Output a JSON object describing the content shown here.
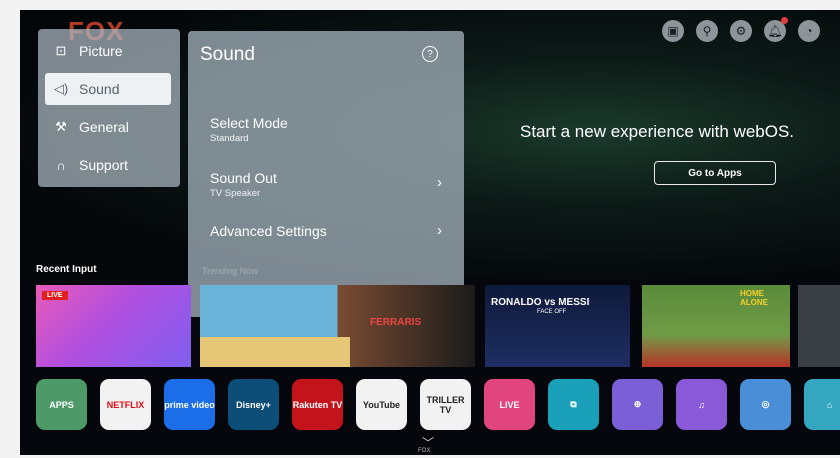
{
  "brand_logo": "FOX",
  "top_icons": [
    "input-icon",
    "search-icon",
    "settings-icon",
    "notifications-icon",
    "account-icon"
  ],
  "promo": {
    "text": "Start a new experience with webOS.",
    "button": "Go to Apps"
  },
  "sidebar": {
    "items": [
      {
        "label": "Picture",
        "icon": "picture-icon"
      },
      {
        "label": "Sound",
        "icon": "speaker-icon",
        "selected": true
      },
      {
        "label": "General",
        "icon": "wrench-icon"
      },
      {
        "label": "Support",
        "icon": "headset-icon"
      }
    ]
  },
  "panel": {
    "title": "Sound",
    "options": [
      {
        "label": "Select Mode",
        "value": "Standard"
      },
      {
        "label": "Sound Out",
        "value": "TV Speaker"
      },
      {
        "label": "Advanced Settings",
        "value": ""
      }
    ],
    "faded_text": "Trending Now"
  },
  "recent_input": "Recent Input",
  "cards": {
    "live_badge": "LIVE",
    "card2_tag": "FERRARIS",
    "card3_title": "RONALDO vs MESSI",
    "card3_sub": "FACE OFF",
    "card4_title": "HOME ALONE"
  },
  "apps": [
    {
      "name": "apps",
      "label": "APPS",
      "bg": "#4d9a68"
    },
    {
      "name": "netflix",
      "label": "NETFLIX",
      "bg": "#f2f2f2",
      "color": "#e50914"
    },
    {
      "name": "prime-video",
      "label": "prime video",
      "bg": "#1b6ee8"
    },
    {
      "name": "disney-plus",
      "label": "Disney+",
      "bg": "#0d4e78"
    },
    {
      "name": "rakuten",
      "label": "Rakuten TV",
      "bg": "#c4141b"
    },
    {
      "name": "youtube",
      "label": "YouTube",
      "bg": "#f2f2f2",
      "color": "#222"
    },
    {
      "name": "triller",
      "label": "TRILLER TV",
      "bg": "#f2f2f2",
      "color": "#222"
    },
    {
      "name": "live-tv",
      "label": "LIVE",
      "bg": "#e0457e"
    },
    {
      "name": "screen-share",
      "label": "⧉",
      "bg": "#1aa0b8"
    },
    {
      "name": "game",
      "label": "⊕",
      "bg": "#7b5fd6"
    },
    {
      "name": "music",
      "label": "♫",
      "bg": "#8a59d8"
    },
    {
      "name": "home-hub",
      "label": "◎",
      "bg": "#4a8ed8"
    },
    {
      "name": "education",
      "label": "⌂",
      "bg": "#35a6c0"
    }
  ],
  "footer_brand": "FOX"
}
